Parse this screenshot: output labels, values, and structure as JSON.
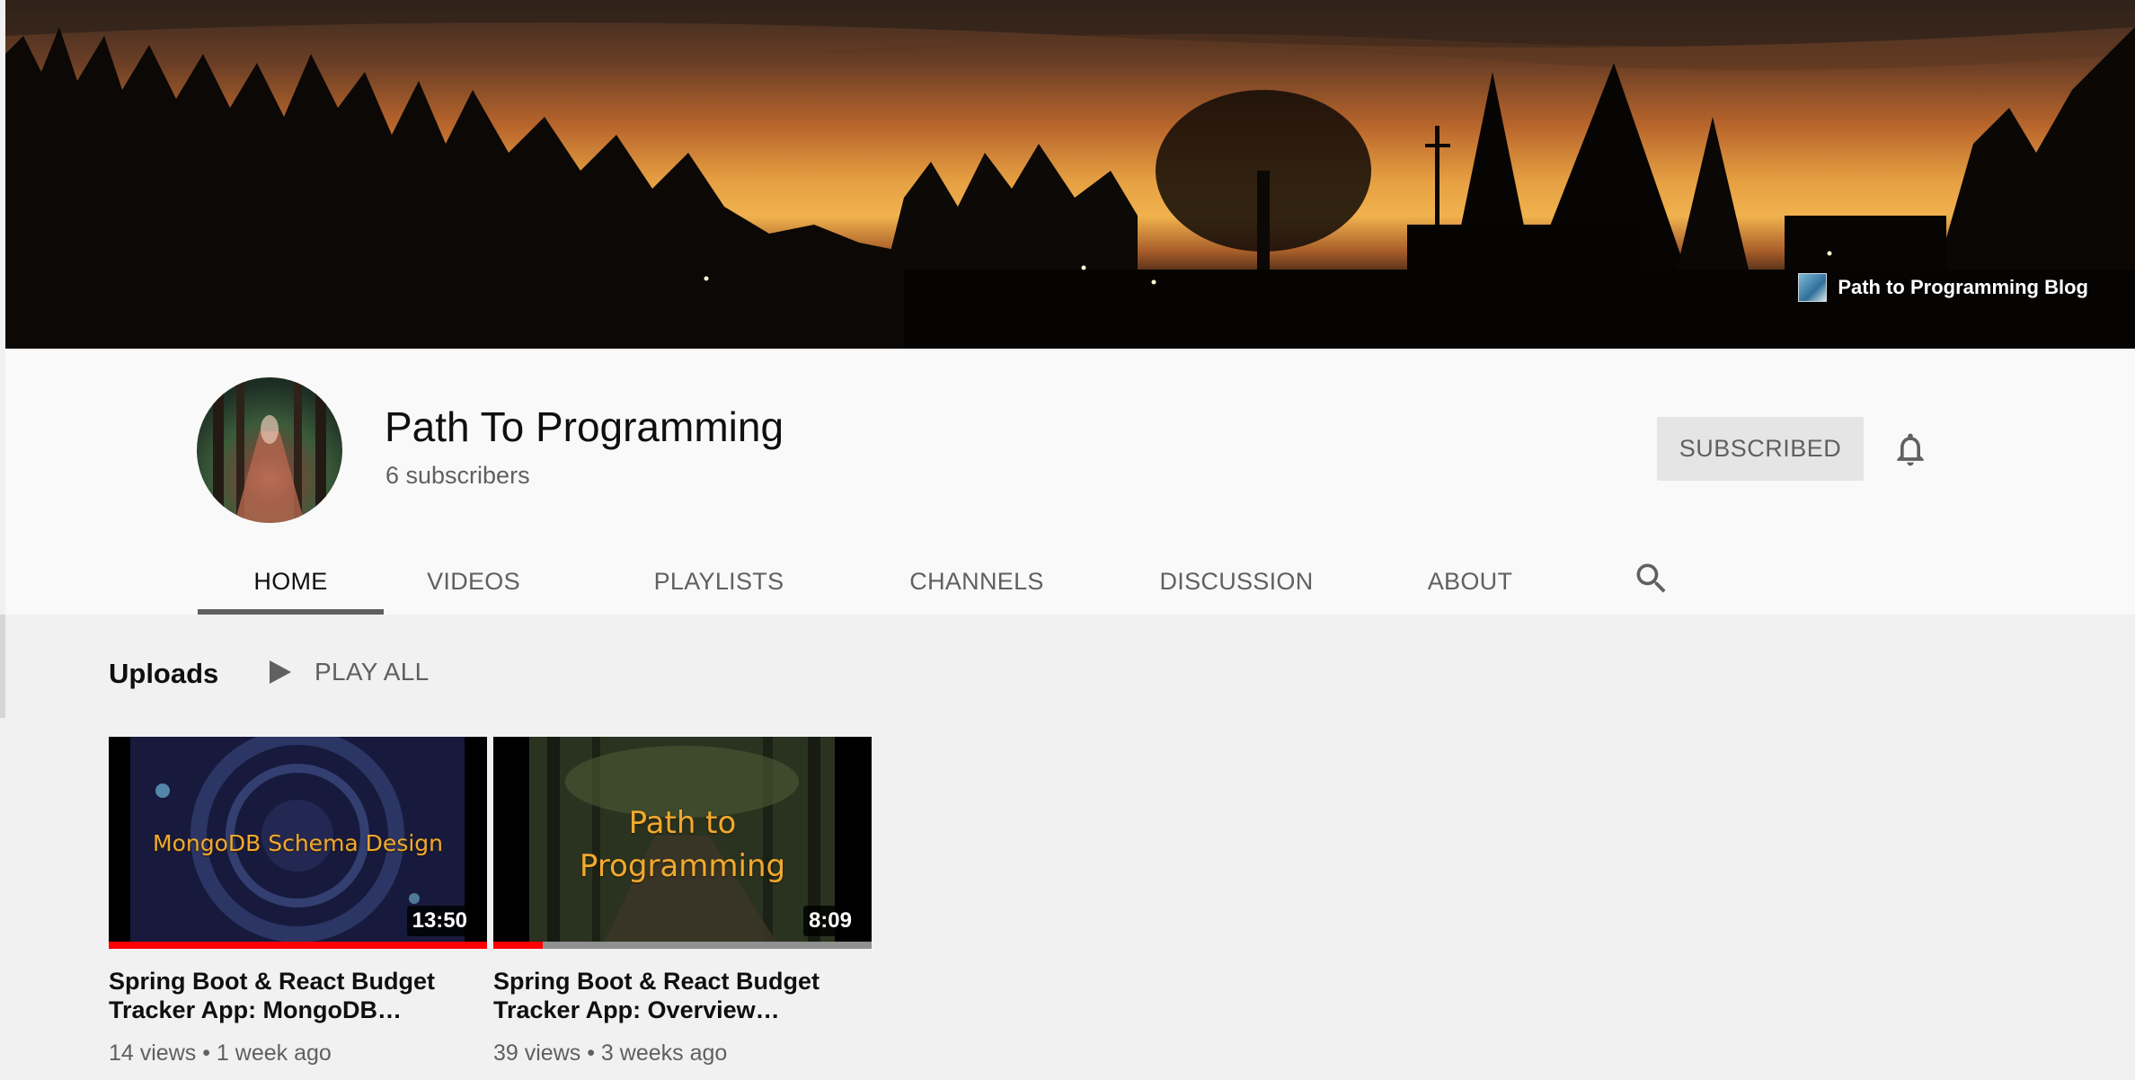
{
  "banner": {
    "link_label": "Path to Programming Blog",
    "link_icon": "blog-favicon-icon"
  },
  "channel": {
    "name": "Path To Programming",
    "subscribers": "6 subscribers",
    "subscribe_label": "SUBSCRIBED",
    "bell_icon": "bell-icon"
  },
  "tabs": [
    {
      "label": "HOME",
      "active": true
    },
    {
      "label": "VIDEOS",
      "active": false
    },
    {
      "label": "PLAYLISTS",
      "active": false
    },
    {
      "label": "CHANNELS",
      "active": false
    },
    {
      "label": "DISCUSSION",
      "active": false
    },
    {
      "label": "ABOUT",
      "active": false
    }
  ],
  "search_icon": "search-icon",
  "uploads": {
    "title": "Uploads",
    "play_all_label": "PLAY ALL",
    "play_icon": "play-icon"
  },
  "videos": [
    {
      "thumb_text": "MongoDB Schema Design",
      "duration": "13:50",
      "watched_fraction": 1.0,
      "title_line1": "Spring Boot & React Budget",
      "title_line2": "Tracker App: MongoDB…",
      "meta": "14 views • 1 week ago"
    },
    {
      "thumb_text_line1": "Path to",
      "thumb_text_line2": "Programming",
      "duration": "8:09",
      "watched_fraction": 0.13,
      "title_line1": "Spring Boot & React Budget",
      "title_line2": "Tracker App: Overview…",
      "meta": "39 views • 3 weeks ago"
    }
  ],
  "colors": {
    "accent_red": "#ff0000",
    "text_secondary": "#606060",
    "thumb_text": "#f0a92f"
  }
}
